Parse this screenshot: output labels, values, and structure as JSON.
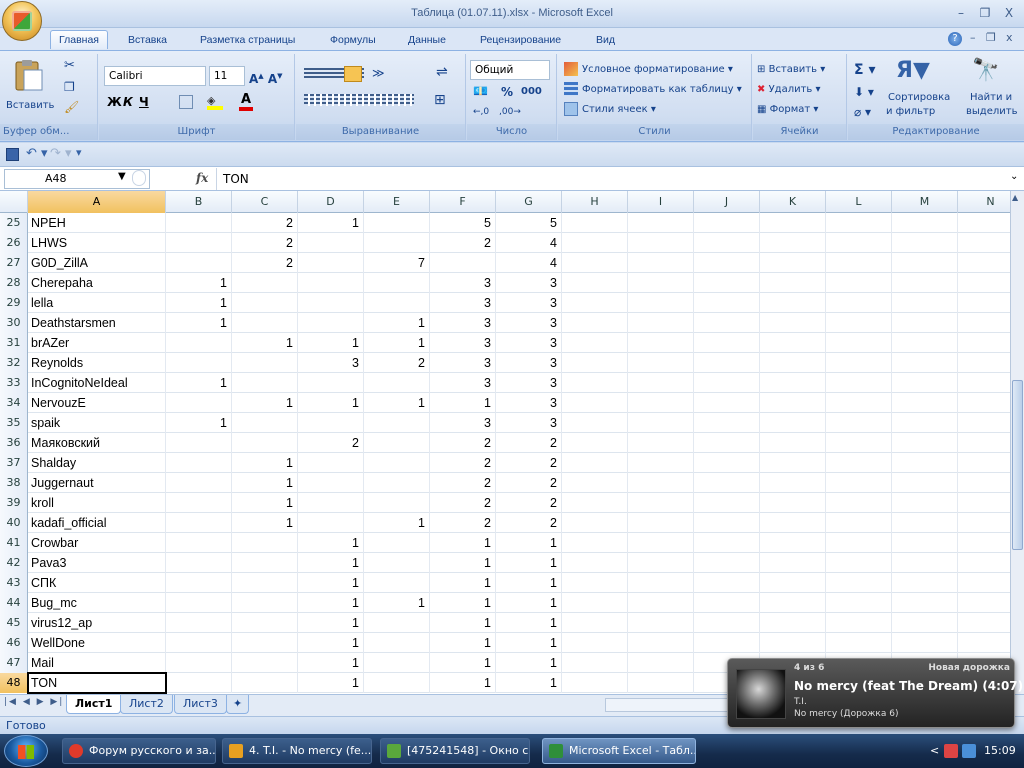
{
  "window": {
    "title": "Таблица (01.07.11).xlsx - Microsoft Excel",
    "minimize": "–",
    "restore": "❐",
    "close": "X"
  },
  "ribbon_tabs": [
    "Главная",
    "Вставка",
    "Разметка страницы",
    "Формулы",
    "Данные",
    "Рецензирование",
    "Вид"
  ],
  "ribbon": {
    "clipboard": {
      "paste": "Вставить",
      "label": "Буфер обм..."
    },
    "font": {
      "name": "Calibri",
      "size": "11",
      "bold": "Ж",
      "italic": "К",
      "underline": "Ч",
      "label": "Шрифт"
    },
    "alignment": {
      "label": "Выравнивание"
    },
    "number": {
      "format": "Общий",
      "percent": "%",
      "thousands": "000",
      "label": "Число"
    },
    "styles": {
      "conditional": "Условное форматирование",
      "as_table": "Форматировать как таблицу",
      "cell_styles": "Стили ячеек",
      "label": "Стили"
    },
    "cells": {
      "insert": "Вставить",
      "delete": "Удалить",
      "format": "Формат",
      "label": "Ячейки"
    },
    "editing": {
      "sort": "Сортировка",
      "sort2": "и фильтр",
      "find": "Найти и",
      "find2": "выделить",
      "label": "Редактирование"
    }
  },
  "formula_bar": {
    "name_box": "A48",
    "fx": "fx",
    "content": "TON"
  },
  "columns": [
    "A",
    "B",
    "C",
    "D",
    "E",
    "F",
    "G",
    "H",
    "I",
    "J",
    "K",
    "L",
    "M",
    "N"
  ],
  "rows": [
    {
      "n": "25",
      "a": "NPEH",
      "b": "",
      "c": "2",
      "d": "1",
      "e": "",
      "f": "5",
      "g": "5"
    },
    {
      "n": "26",
      "a": "LHWS",
      "b": "",
      "c": "2",
      "d": "",
      "e": "",
      "f": "2",
      "g": "4"
    },
    {
      "n": "27",
      "a": "G0D_ZillA",
      "b": "",
      "c": "2",
      "d": "",
      "e": "7",
      "f": "",
      "g": "4"
    },
    {
      "n": "28",
      "a": "Cherepaha",
      "b": "1",
      "c": "",
      "d": "",
      "e": "",
      "f": "3",
      "g": "3"
    },
    {
      "n": "29",
      "a": "lella",
      "b": "1",
      "c": "",
      "d": "",
      "e": "",
      "f": "3",
      "g": "3"
    },
    {
      "n": "30",
      "a": "Deathstarsmen",
      "b": "1",
      "c": "",
      "d": "",
      "e": "1",
      "f": "3",
      "g": "3"
    },
    {
      "n": "31",
      "a": "brAZer",
      "b": "",
      "c": "1",
      "d": "1",
      "e": "1",
      "f": "3",
      "g": "3"
    },
    {
      "n": "32",
      "a": "Reynolds",
      "b": "",
      "c": "",
      "d": "3",
      "e": "2",
      "f": "3",
      "g": "3"
    },
    {
      "n": "33",
      "a": "InCognitoNeIdeal",
      "b": "1",
      "c": "",
      "d": "",
      "e": "",
      "f": "3",
      "g": "3"
    },
    {
      "n": "34",
      "a": "NervouzE",
      "b": "",
      "c": "1",
      "d": "1",
      "e": "1",
      "f": "1",
      "g": "3"
    },
    {
      "n": "35",
      "a": "spaik",
      "b": "1",
      "c": "",
      "d": "",
      "e": "",
      "f": "3",
      "g": "3"
    },
    {
      "n": "36",
      "a": "Маяковский",
      "b": "",
      "c": "",
      "d": "2",
      "e": "",
      "f": "2",
      "g": "2"
    },
    {
      "n": "37",
      "a": "Shalday",
      "b": "",
      "c": "1",
      "d": "",
      "e": "",
      "f": "2",
      "g": "2"
    },
    {
      "n": "38",
      "a": "Juggernaut",
      "b": "",
      "c": "1",
      "d": "",
      "e": "",
      "f": "2",
      "g": "2"
    },
    {
      "n": "39",
      "a": "kroll",
      "b": "",
      "c": "1",
      "d": "",
      "e": "",
      "f": "2",
      "g": "2"
    },
    {
      "n": "40",
      "a": "kadafi_official",
      "b": "",
      "c": "1",
      "d": "",
      "e": "1",
      "f": "2",
      "g": "2"
    },
    {
      "n": "41",
      "a": "Crowbar",
      "b": "",
      "c": "",
      "d": "1",
      "e": "",
      "f": "1",
      "g": "1"
    },
    {
      "n": "42",
      "a": "Pava3",
      "b": "",
      "c": "",
      "d": "1",
      "e": "",
      "f": "1",
      "g": "1"
    },
    {
      "n": "43",
      "a": "СПК",
      "b": "",
      "c": "",
      "d": "1",
      "e": "",
      "f": "1",
      "g": "1"
    },
    {
      "n": "44",
      "a": "Bug_mc",
      "b": "",
      "c": "",
      "d": "1",
      "e": "1",
      "f": "1",
      "g": "1"
    },
    {
      "n": "45",
      "a": "virus12_ap",
      "b": "",
      "c": "",
      "d": "1",
      "e": "",
      "f": "1",
      "g": "1"
    },
    {
      "n": "46",
      "a": "WellDone",
      "b": "",
      "c": "",
      "d": "1",
      "e": "",
      "f": "1",
      "g": "1"
    },
    {
      "n": "47",
      "a": "Mail",
      "b": "",
      "c": "",
      "d": "1",
      "e": "",
      "f": "1",
      "g": "1"
    },
    {
      "n": "48",
      "a": "TON",
      "b": "",
      "c": "",
      "d": "1",
      "e": "",
      "f": "1",
      "g": "1"
    }
  ],
  "sheet_tabs": [
    "Лист1",
    "Лист2",
    "Лист3"
  ],
  "status": "Готово",
  "media_popup": {
    "counter": "4 из 6",
    "header": "Новая дорожка",
    "track": "No mercy (feat The Dream) (4:07)",
    "artist": "T.I.",
    "album": "No mercy (Дорожка 6)"
  },
  "taskbar": [
    {
      "label": "Форум русского и за...",
      "color": "#e03a2a"
    },
    {
      "label": "4. T.I. - No mercy (fe...",
      "color": "#e8a020"
    },
    {
      "label": "[475241548] - Окно с...",
      "color": "#5aa83c"
    },
    {
      "label": "Microsoft Excel - Табл...",
      "color": "#2f8f3a"
    }
  ],
  "clock": "15:09",
  "tray_lang": "<"
}
